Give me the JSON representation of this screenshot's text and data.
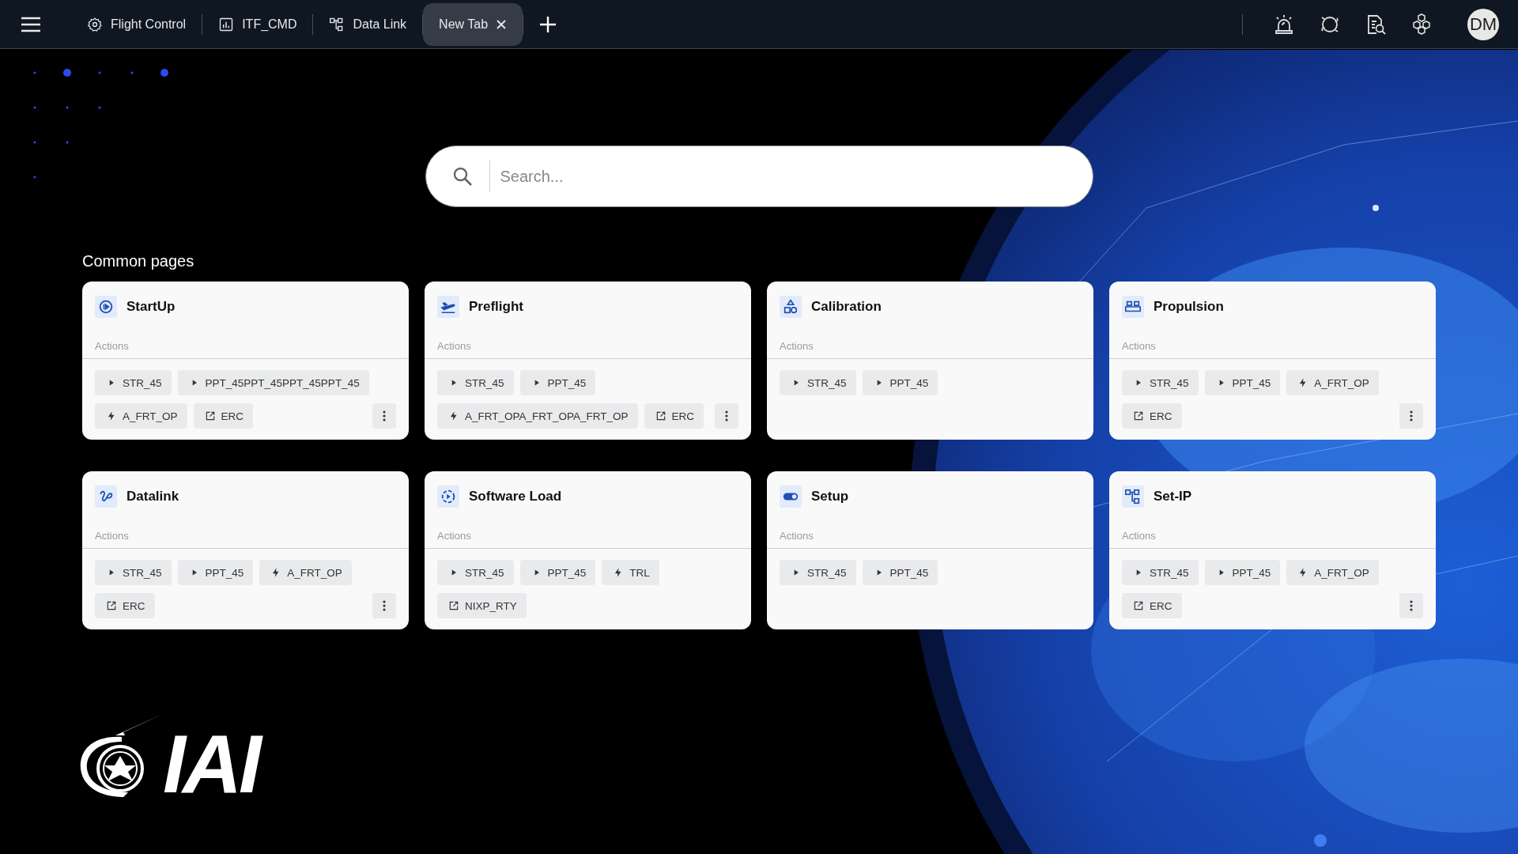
{
  "top_bar": {
    "tabs": [
      {
        "label": "Flight Control",
        "selected": false
      },
      {
        "label": "ITF_CMD",
        "selected": false
      },
      {
        "label": "Data Link",
        "selected": false
      },
      {
        "label": "New Tab",
        "selected": true
      }
    ],
    "avatar": "DM"
  },
  "search": {
    "placeholder": "Search..."
  },
  "section_title": "Common pages",
  "cards": [
    {
      "title": "StartUp",
      "actions_label": "Actions",
      "more_menu": true,
      "chips": [
        {
          "kind": "run",
          "label": "STR_45"
        },
        {
          "kind": "run",
          "label": "PPT_45PPT_45PPT_45PPT_45"
        },
        {
          "kind": "trigger",
          "label": "A_FRT_OP"
        },
        {
          "kind": "open",
          "label": "ERC"
        }
      ]
    },
    {
      "title": "Preflight",
      "actions_label": "Actions",
      "more_menu": true,
      "chips": [
        {
          "kind": "run",
          "label": "STR_45"
        },
        {
          "kind": "run",
          "label": "PPT_45"
        },
        {
          "kind": "trigger",
          "label": "A_FRT_OPA_FRT_OPA_FRT_OP"
        },
        {
          "kind": "open",
          "label": "ERC"
        }
      ]
    },
    {
      "title": "Calibration",
      "actions_label": "Actions",
      "more_menu": false,
      "chips": [
        {
          "kind": "run",
          "label": "STR_45"
        },
        {
          "kind": "run",
          "label": "PPT_45"
        }
      ]
    },
    {
      "title": "Propulsion",
      "actions_label": "Actions",
      "more_menu": true,
      "chips": [
        {
          "kind": "run",
          "label": "STR_45"
        },
        {
          "kind": "run",
          "label": "PPT_45"
        },
        {
          "kind": "trigger",
          "label": "A_FRT_OP"
        },
        {
          "kind": "open",
          "label": "ERC"
        }
      ]
    },
    {
      "title": "Datalink",
      "actions_label": "Actions",
      "more_menu": true,
      "chips": [
        {
          "kind": "run",
          "label": "STR_45"
        },
        {
          "kind": "run",
          "label": "PPT_45"
        },
        {
          "kind": "trigger",
          "label": "A_FRT_OP"
        },
        {
          "kind": "open",
          "label": "ERC"
        }
      ]
    },
    {
      "title": "Software Load",
      "actions_label": "Actions",
      "more_menu": false,
      "chips": [
        {
          "kind": "run",
          "label": "STR_45"
        },
        {
          "kind": "run",
          "label": "PPT_45"
        },
        {
          "kind": "trigger",
          "label": "TRL"
        },
        {
          "kind": "open",
          "label": "NIXP_RTY"
        }
      ]
    },
    {
      "title": "Setup",
      "actions_label": "Actions",
      "more_menu": false,
      "chips": [
        {
          "kind": "run",
          "label": "STR_45"
        },
        {
          "kind": "run",
          "label": "PPT_45"
        }
      ]
    },
    {
      "title": "Set-IP",
      "actions_label": "Actions",
      "more_menu": true,
      "chips": [
        {
          "kind": "run",
          "label": "STR_45"
        },
        {
          "kind": "run",
          "label": "PPT_45"
        },
        {
          "kind": "trigger",
          "label": "A_FRT_OP"
        },
        {
          "kind": "open",
          "label": "ERC"
        }
      ]
    }
  ],
  "logo": {
    "text": "IAI"
  }
}
